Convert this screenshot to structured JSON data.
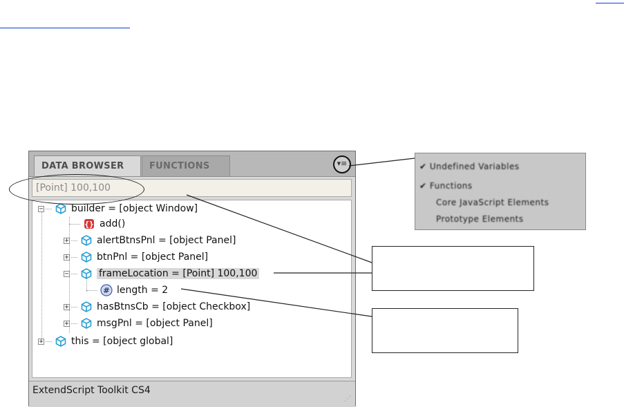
{
  "panel": {
    "tabs": [
      {
        "label": "DATA BROWSER",
        "active": true
      },
      {
        "label": "FUNCTIONS",
        "active": false
      }
    ],
    "menu_icon": "flyout-menu-icon",
    "selected_value": "[Point] 100,100",
    "status": "ExtendScript Toolkit CS4"
  },
  "tree": {
    "builder": "builder = [object Window]",
    "add": "add()",
    "alertBtnsPnl": "alertBtnsPnl = [object Panel]",
    "btnPnl": "btnPnl = [object Panel]",
    "frameLocation": "frameLocation = [Point] 100,100",
    "length": "length = 2",
    "hasBtnsCb": "hasBtnsCb = [object Checkbox]",
    "msgPnl": "msgPnl = [object Panel]",
    "this": "this = [object global]"
  },
  "popup_menu": {
    "items": [
      "Undefined Variables",
      "Functions",
      "Core JavaScript Elements",
      "Prototype Elements"
    ]
  },
  "colors": {
    "object_icon": "#2a9fd6",
    "function_icon": "#d23b3b",
    "number_icon": "#3a5fb0",
    "link": "#0d3bd6"
  }
}
